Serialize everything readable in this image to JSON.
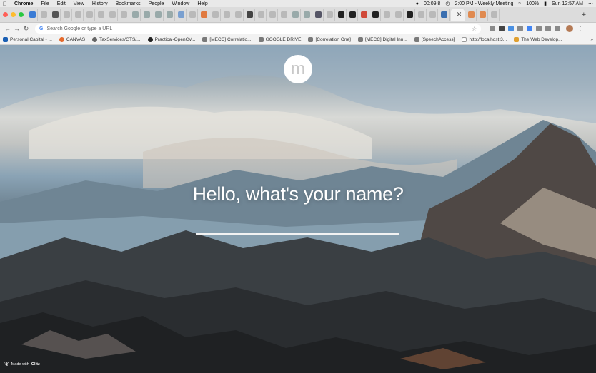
{
  "menubar": {
    "app": "Chrome",
    "items": [
      "File",
      "Edit",
      "View",
      "History",
      "Bookmarks",
      "People",
      "Window",
      "Help"
    ],
    "timer": "00:09.8",
    "event": "2:00 PM - Weekly Meeting",
    "battery": "100%",
    "clock": "Sun 12:57 AM"
  },
  "toolbar": {
    "omnibox_placeholder": "Search Google or type a URL"
  },
  "bookmarks": [
    {
      "label": "Personal Capital - ...",
      "color": "#1a5fb4"
    },
    {
      "label": "CANVAS",
      "color": "#e66a2c"
    },
    {
      "label": "TaxServices/GTS/...",
      "color": "#666666"
    },
    {
      "label": "Practical-OpenCV...",
      "color": "#222222"
    },
    {
      "label": "[MECC] Correlatio...",
      "color": "#7a7a7a"
    },
    {
      "label": "GOOGLE DRIVE",
      "color": "#7a7a7a"
    },
    {
      "label": "[Correlation One]",
      "color": "#7a7a7a"
    },
    {
      "label": "[MECC] Digital Inn...",
      "color": "#7a7a7a"
    },
    {
      "label": "[SpeechAccess]",
      "color": "#7a7a7a"
    },
    {
      "label": "http://localhost:3...",
      "color": "#888888"
    },
    {
      "label": "The Web Develop...",
      "color": "#e0a030"
    }
  ],
  "page": {
    "logo_letter": "m",
    "greeting": "Hello, what's your name?",
    "name_value": "",
    "made_with_label": "Made with",
    "made_with_brand": "Glitz"
  },
  "colors": {
    "menubar_bg": "#e9e9e9",
    "tabstrip_bg": "#dcdcdc",
    "toolbar_bg": "#f2f2f2",
    "close_red": "#ff5f57",
    "minimize_yellow": "#febc2e",
    "zoom_green": "#28c840"
  }
}
